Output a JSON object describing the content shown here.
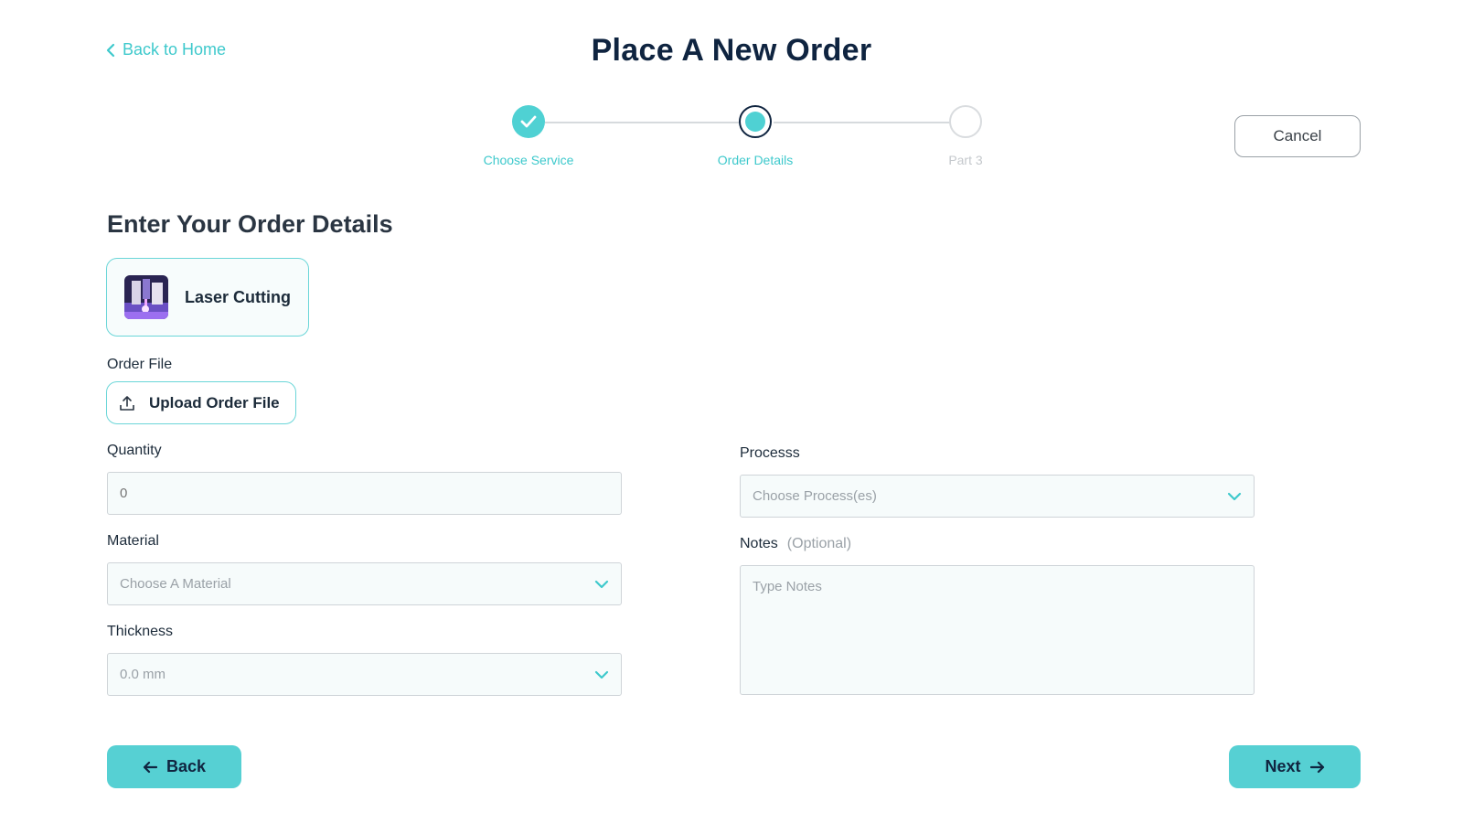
{
  "header": {
    "back_link": "Back to Home",
    "title": "Place A New Order"
  },
  "stepper": {
    "steps": [
      {
        "label": "Choose Service",
        "state": "done"
      },
      {
        "label": "Order Details",
        "state": "active"
      },
      {
        "label": "Part 3",
        "state": "todo"
      }
    ]
  },
  "cancel_label": "Cancel",
  "section_title": "Enter Your Order Details",
  "service": {
    "name": "Laser Cutting"
  },
  "order_file": {
    "label": "Order File",
    "upload_label": "Upload Order File"
  },
  "quantity": {
    "label": "Quantity",
    "placeholder": "0"
  },
  "material": {
    "label": "Material",
    "placeholder": "Choose A Material"
  },
  "thickness": {
    "label": "Thickness",
    "value": "0.0 mm"
  },
  "process": {
    "label": "Processs",
    "placeholder": "Choose Process(es)"
  },
  "notes": {
    "label": "Notes",
    "optional": "(Optional)",
    "placeholder": "Type Notes"
  },
  "footer": {
    "back_label": "Back",
    "next_label": "Next"
  },
  "colors": {
    "accent": "#56d0d3",
    "navy": "#0f2440"
  }
}
